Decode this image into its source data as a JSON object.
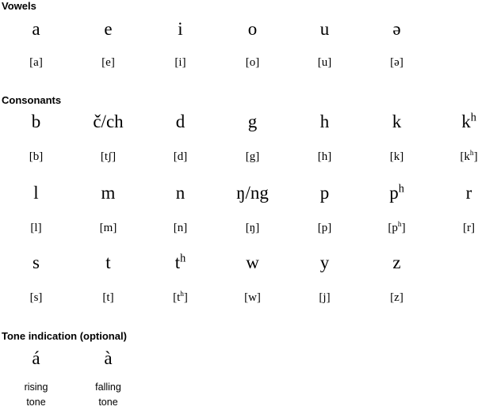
{
  "sections": {
    "vowels": {
      "title": "Vowels",
      "letters": [
        "a",
        "e",
        "i",
        "o",
        "u",
        "ə"
      ],
      "ipa": [
        "[a]",
        "[e]",
        "[i]",
        "[o]",
        "[u]",
        "[ə]"
      ]
    },
    "consonants": {
      "title": "Consonants",
      "rows": [
        {
          "letters": [
            "b",
            "č/ch",
            "d",
            "g",
            "h",
            "k",
            "kʰ"
          ],
          "letters_base": [
            "b",
            "č/ch",
            "d",
            "g",
            "h",
            "k",
            "k"
          ],
          "letters_sup": [
            "",
            "",
            "",
            "",
            "",
            "",
            "h"
          ],
          "ipa": [
            "[b]",
            "[tʃ]",
            "[d]",
            "[g]",
            "[h]",
            "[k]",
            "[kʰ]"
          ],
          "ipa_base": [
            "[b]",
            "[tʃ]",
            "[d]",
            "[g]",
            "[h]",
            "[k]",
            "[k"
          ],
          "ipa_sup": [
            "",
            "",
            "",
            "",
            "",
            "",
            "h"
          ],
          "ipa_tail": [
            "",
            "",
            "",
            "",
            "",
            "",
            "]"
          ]
        },
        {
          "letters": [
            "l",
            "m",
            "n",
            "ŋ/ng",
            "p",
            "pʰ",
            "r"
          ],
          "letters_base": [
            "l",
            "m",
            "n",
            "ŋ/ng",
            "p",
            "p",
            "r"
          ],
          "letters_sup": [
            "",
            "",
            "",
            "",
            "",
            "h",
            ""
          ],
          "ipa": [
            "[l]",
            "[m]",
            "[n]",
            "[ŋ]",
            "[p]",
            "[pʰ]",
            "[r]"
          ],
          "ipa_base": [
            "[l]",
            "[m]",
            "[n]",
            "[ŋ]",
            "[p]",
            "[p",
            "[r]"
          ],
          "ipa_sup": [
            "",
            "",
            "",
            "",
            "",
            "h",
            ""
          ],
          "ipa_tail": [
            "",
            "",
            "",
            "",
            "",
            "]",
            ""
          ]
        },
        {
          "letters": [
            "s",
            "t",
            "tʰ",
            "w",
            "y",
            "z",
            ""
          ],
          "letters_base": [
            "s",
            "t",
            "t",
            "w",
            "y",
            "z",
            ""
          ],
          "letters_sup": [
            "",
            "",
            "h",
            "",
            "",
            "",
            ""
          ],
          "ipa": [
            "[s]",
            "[t]",
            "[tʰ]",
            "[w]",
            "[j]",
            "[z]",
            ""
          ],
          "ipa_base": [
            "[s]",
            "[t]",
            "[t",
            "[w]",
            "[j]",
            "[z]",
            ""
          ],
          "ipa_sup": [
            "",
            "",
            "h",
            "",
            "",
            "",
            ""
          ],
          "ipa_tail": [
            "",
            "",
            "]",
            "",
            "",
            "",
            ""
          ]
        }
      ]
    },
    "tone": {
      "title": "Tone indication (optional)",
      "letters": [
        "á",
        "à"
      ],
      "labels": [
        {
          "line1": "rising",
          "line2": "tone"
        },
        {
          "line1": "falling",
          "line2": "tone"
        }
      ]
    }
  },
  "colors": {
    "background": "#ffffff",
    "text": "#000000"
  }
}
